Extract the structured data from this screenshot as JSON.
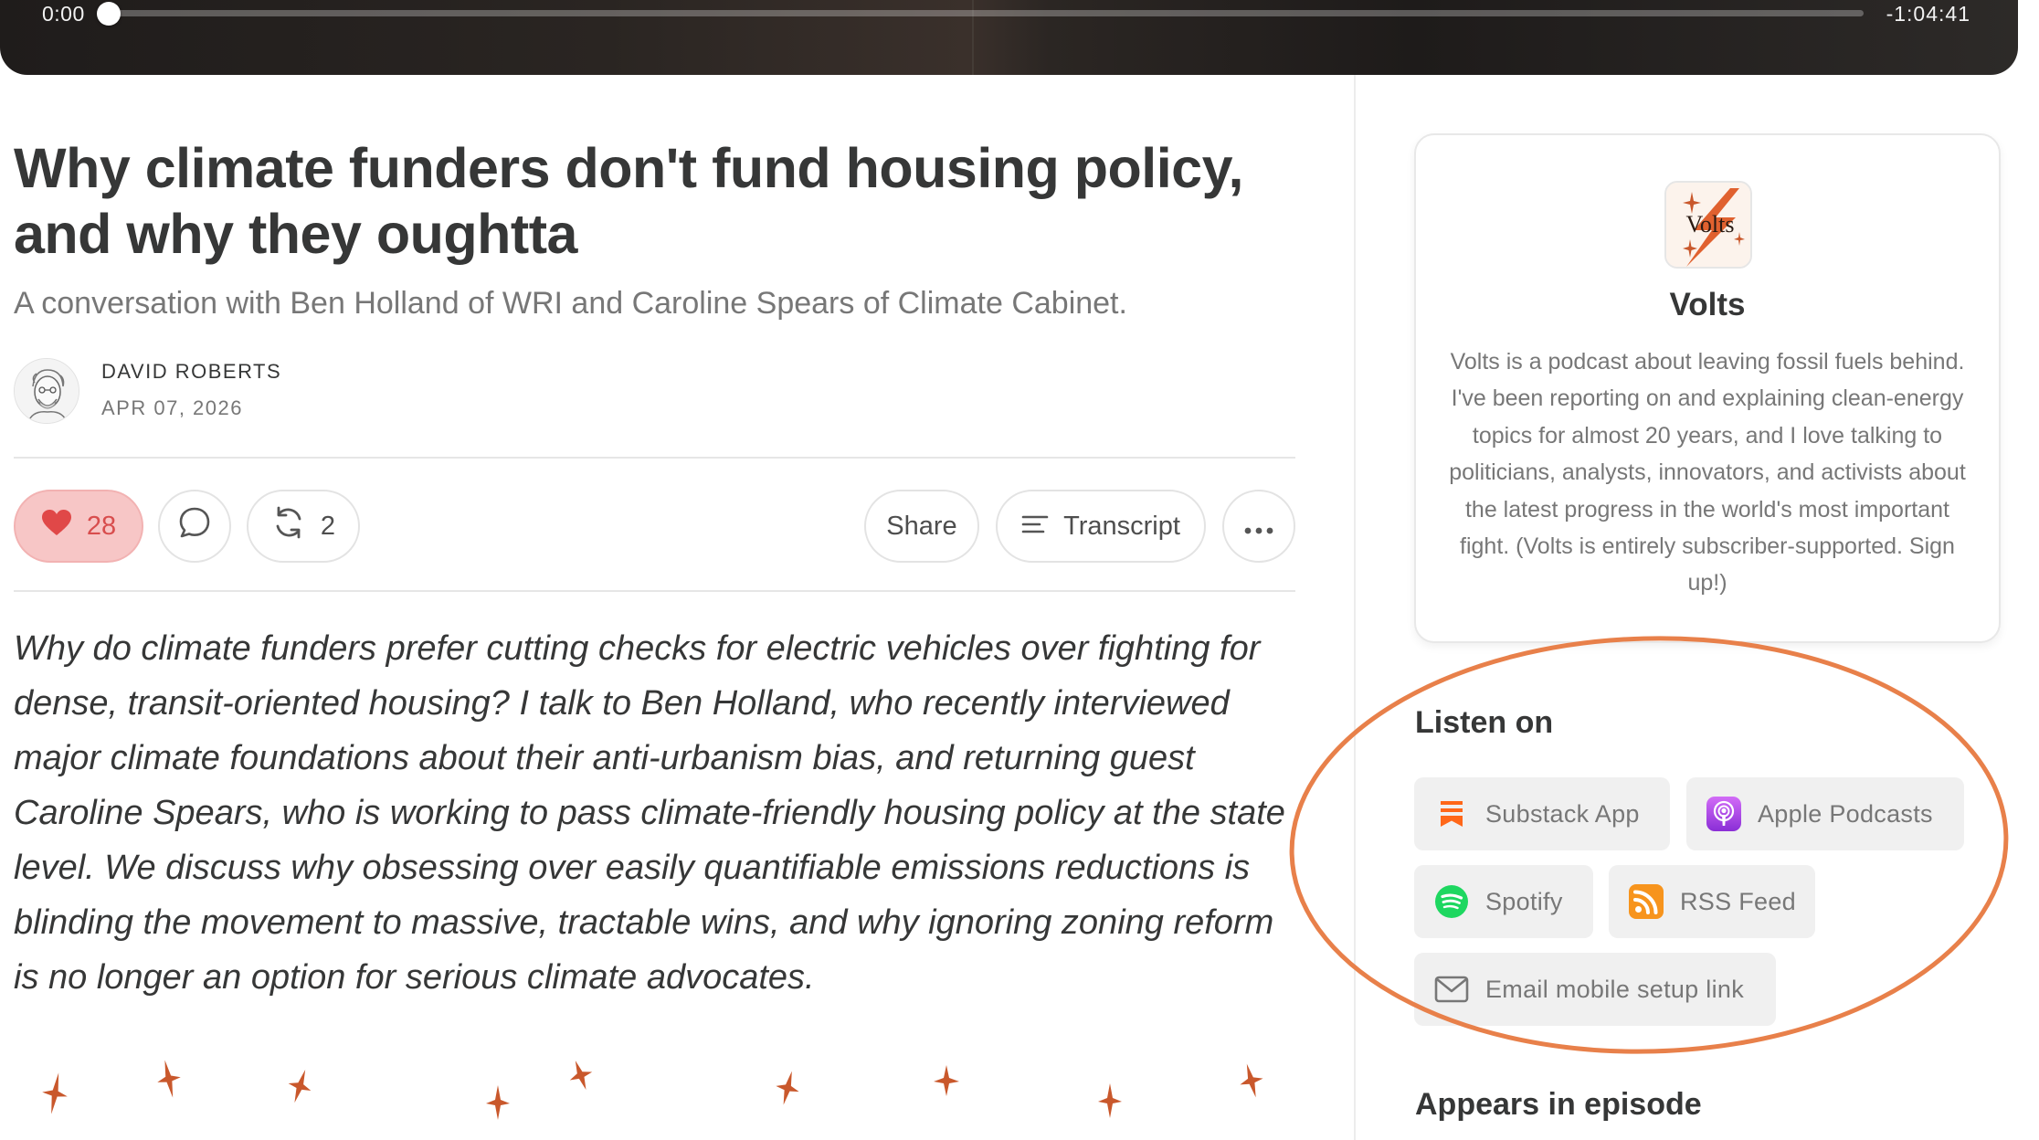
{
  "player": {
    "elapsed": "0:00",
    "remaining": "-1:04:41",
    "progress_fraction": 0.0
  },
  "post": {
    "title": "Why climate funders don't fund housing policy, and why they oughtta",
    "subtitle": "A conversation with Ben Holland of WRI and Caroline Spears of Climate Cabinet.",
    "author": "DAVID ROBERTS",
    "date": "APR 07, 2026",
    "description": "Why do climate funders prefer cutting checks for electric vehicles over fighting for dense, transit-oriented housing? I talk to Ben Holland, who recently interviewed major climate foundations about their anti-urbanism bias, and returning guest Caroline Spears, who is working to pass climate-friendly housing policy at the state level. We discuss why obsessing over easily quantifiable emissions reductions is blinding the movement to massive, tractable wins, and why ignoring zoning reform is no longer an option for serious climate advocates."
  },
  "actions": {
    "like_count": "28",
    "restack_count": "2",
    "share_label": "Share",
    "transcript_label": "Transcript"
  },
  "sidebar": {
    "podcast_name": "Volts",
    "logo_text": "Volts",
    "podcast_description": "Volts is a podcast about leaving fossil fuels behind. I've been reporting on and explaining clean-energy topics for almost 20 years, and I love talking to politicians, analysts, innovators, and activists about the latest progress in the world's most important fight. (Volts is entirely subscriber-supported. Sign up!)",
    "listen_on_title": "Listen on",
    "listen_options": {
      "substack": "Substack App",
      "apple": "Apple Podcasts",
      "spotify": "Spotify",
      "rss": "RSS Feed",
      "email": "Email mobile setup link"
    },
    "appears_title": "Appears in episode"
  },
  "colors": {
    "accent_orange": "#e8804a",
    "like_bg": "#f7c6c6",
    "like_fg": "#d84d4d",
    "spotify_green": "#1ed760",
    "apple_purple": "#a33ee0",
    "rss_orange": "#f7941d",
    "substack_orange": "#ff6719"
  }
}
